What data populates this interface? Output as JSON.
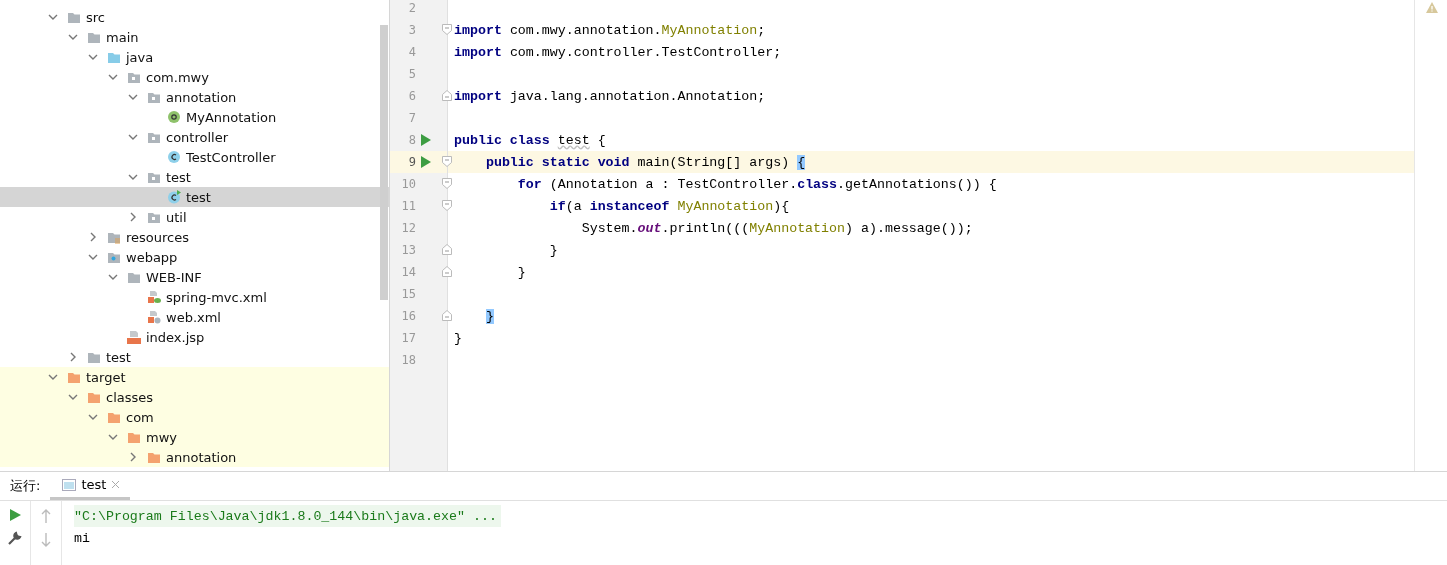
{
  "project_tree": [
    {
      "label": "src",
      "kind": "folder",
      "expanded": true,
      "selected": false,
      "excluded": false,
      "children": [
        {
          "label": "main",
          "kind": "folder",
          "expanded": true,
          "selected": false,
          "excluded": false,
          "children": [
            {
              "label": "java",
              "kind": "source-folder",
              "expanded": true,
              "selected": false,
              "excluded": false,
              "children": [
                {
                  "label": "com.mwy",
                  "kind": "package",
                  "expanded": true,
                  "selected": false,
                  "excluded": false,
                  "children": [
                    {
                      "label": "annotation",
                      "kind": "package",
                      "expanded": true,
                      "selected": false,
                      "excluded": false,
                      "children": [
                        {
                          "label": "MyAnnotation",
                          "kind": "annotation",
                          "selected": false,
                          "excluded": false
                        }
                      ]
                    },
                    {
                      "label": "controller",
                      "kind": "package",
                      "expanded": true,
                      "selected": false,
                      "excluded": false,
                      "children": [
                        {
                          "label": "TestController",
                          "kind": "class",
                          "selected": false,
                          "excluded": false
                        }
                      ]
                    },
                    {
                      "label": "test",
                      "kind": "package",
                      "expanded": true,
                      "selected": false,
                      "excluded": false,
                      "children": [
                        {
                          "label": "test",
                          "kind": "runnable-class",
                          "selected": true,
                          "excluded": false
                        }
                      ]
                    },
                    {
                      "label": "util",
                      "kind": "package",
                      "expanded": false,
                      "selected": false,
                      "excluded": false
                    }
                  ]
                }
              ]
            },
            {
              "label": "resources",
              "kind": "resources-folder",
              "expanded": false,
              "selected": false,
              "excluded": false
            },
            {
              "label": "webapp",
              "kind": "web-folder",
              "expanded": true,
              "selected": false,
              "excluded": false,
              "children": [
                {
                  "label": "WEB-INF",
                  "kind": "folder",
                  "expanded": true,
                  "selected": false,
                  "excluded": false,
                  "children": [
                    {
                      "label": "spring-mvc.xml",
                      "kind": "spring-xml",
                      "selected": false,
                      "excluded": false
                    },
                    {
                      "label": "web.xml",
                      "kind": "web-xml",
                      "selected": false,
                      "excluded": false
                    }
                  ]
                },
                {
                  "label": "index.jsp",
                  "kind": "jsp",
                  "selected": false,
                  "excluded": false
                }
              ]
            }
          ]
        },
        {
          "label": "test",
          "kind": "folder",
          "expanded": false,
          "selected": false,
          "excluded": false
        }
      ]
    },
    {
      "label": "target",
      "kind": "folder",
      "expanded": true,
      "selected": false,
      "excluded": true,
      "children": [
        {
          "label": "classes",
          "kind": "folder",
          "expanded": true,
          "selected": false,
          "excluded": true,
          "children": [
            {
              "label": "com",
              "kind": "folder",
              "expanded": true,
              "selected": false,
              "excluded": true,
              "children": [
                {
                  "label": "mwy",
                  "kind": "folder",
                  "expanded": true,
                  "selected": false,
                  "excluded": true,
                  "children": [
                    {
                      "label": "annotation",
                      "kind": "folder",
                      "expanded": false,
                      "selected": false,
                      "excluded": true
                    }
                  ]
                }
              ]
            }
          ]
        }
      ]
    }
  ],
  "editor": {
    "lines": [
      {
        "number": "2",
        "current": false,
        "run": false,
        "fold_open": false,
        "fold_close": false
      },
      {
        "number": "3",
        "current": false,
        "run": false,
        "fold_open": true,
        "fold_close": false,
        "tokens": [
          {
            "kind": "keyword",
            "text": "import"
          },
          {
            "kind": "plain",
            "text": " com.mwy.annotation."
          },
          {
            "kind": "type",
            "text": "MyAnnotation"
          },
          {
            "kind": "plain",
            "text": ";"
          }
        ]
      },
      {
        "number": "4",
        "current": false,
        "run": false,
        "fold_open": false,
        "fold_close": false,
        "tokens": [
          {
            "kind": "keyword",
            "text": "import"
          },
          {
            "kind": "plain",
            "text": " com.mwy.controller.TestController;"
          }
        ]
      },
      {
        "number": "5",
        "current": false,
        "run": false,
        "fold_open": false,
        "fold_close": false
      },
      {
        "number": "6",
        "current": false,
        "run": false,
        "fold_open": false,
        "fold_close": true,
        "tokens": [
          {
            "kind": "keyword",
            "text": "import"
          },
          {
            "kind": "plain",
            "text": " java.lang.annotation.Annotation;"
          }
        ]
      },
      {
        "number": "7",
        "current": false,
        "run": false,
        "fold_open": false,
        "fold_close": false
      },
      {
        "number": "8",
        "current": false,
        "run": true,
        "fold_open": false,
        "fold_close": false,
        "tokens": [
          {
            "kind": "keyword",
            "text": "public class"
          },
          {
            "kind": "warning",
            "text": " test"
          },
          {
            "kind": "plain",
            "text": " {"
          }
        ]
      },
      {
        "number": "9",
        "current": true,
        "run": true,
        "fold_open": true,
        "fold_close": false,
        "tokens": [
          {
            "kind": "keyword",
            "text": "    public static void"
          },
          {
            "kind": "plain",
            "text": " main(String[] args) "
          },
          {
            "kind": "match",
            "text": "{"
          }
        ]
      },
      {
        "number": "10",
        "current": false,
        "run": false,
        "fold_open": true,
        "fold_close": false,
        "tokens": [
          {
            "kind": "keyword",
            "text": "        for"
          },
          {
            "kind": "plain",
            "text": " (Annotation a : TestController."
          },
          {
            "kind": "keyword",
            "text": "class"
          },
          {
            "kind": "plain",
            "text": ".getAnnotations()) {"
          }
        ]
      },
      {
        "number": "11",
        "current": false,
        "run": false,
        "fold_open": true,
        "fold_close": false,
        "tokens": [
          {
            "kind": "keyword",
            "text": "            if"
          },
          {
            "kind": "plain",
            "text": "(a "
          },
          {
            "kind": "keyword",
            "text": "instanceof"
          },
          {
            "kind": "type",
            "text": " MyAnnotation"
          },
          {
            "kind": "plain",
            "text": "){"
          }
        ]
      },
      {
        "number": "12",
        "current": false,
        "run": false,
        "fold_open": false,
        "fold_close": false,
        "tokens": [
          {
            "kind": "plain",
            "text": "                System."
          },
          {
            "kind": "static",
            "text": "out"
          },
          {
            "kind": "plain",
            "text": ".println((("
          },
          {
            "kind": "type",
            "text": "MyAnnotation"
          },
          {
            "kind": "plain",
            "text": ") a).message());"
          }
        ]
      },
      {
        "number": "13",
        "current": false,
        "run": false,
        "fold_open": false,
        "fold_close": true,
        "tokens": [
          {
            "kind": "plain",
            "text": "            }"
          }
        ]
      },
      {
        "number": "14",
        "current": false,
        "run": false,
        "fold_open": false,
        "fold_close": true,
        "tokens": [
          {
            "kind": "plain",
            "text": "        }"
          }
        ]
      },
      {
        "number": "15",
        "current": false,
        "run": false,
        "fold_open": false,
        "fold_close": false
      },
      {
        "number": "16",
        "current": false,
        "run": false,
        "fold_open": false,
        "fold_close": true,
        "tokens": [
          {
            "kind": "match",
            "text": "    }"
          }
        ]
      },
      {
        "number": "17",
        "current": false,
        "run": false,
        "fold_open": false,
        "fold_close": false,
        "tokens": [
          {
            "kind": "plain",
            "text": "}"
          }
        ]
      },
      {
        "number": "18",
        "current": false,
        "run": false,
        "fold_open": false,
        "fold_close": false
      }
    ]
  },
  "run_panel": {
    "label": "运行:",
    "tabs": [
      {
        "label": "test",
        "selected": true
      }
    ],
    "console": [
      {
        "kind": "command",
        "text": "\"C:\\Program Files\\Java\\jdk1.8.0_144\\bin\\java.exe\" ..."
      },
      {
        "kind": "output",
        "text": "mi"
      }
    ]
  }
}
